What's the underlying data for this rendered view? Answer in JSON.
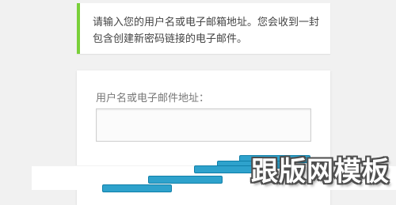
{
  "message": {
    "line1": "请输入您的用户名或电子邮箱地址。您会收到一封",
    "line2": "包含创建新密码链接的电子邮件。"
  },
  "form": {
    "username_label": "用户名或电子邮件地址：",
    "username_value": ""
  },
  "watermark": {
    "text": "跟版网模板"
  },
  "colors": {
    "accent_green": "#7ad03a",
    "button_blue": "#2ea2cc",
    "button_border": "#0f7fa8"
  }
}
